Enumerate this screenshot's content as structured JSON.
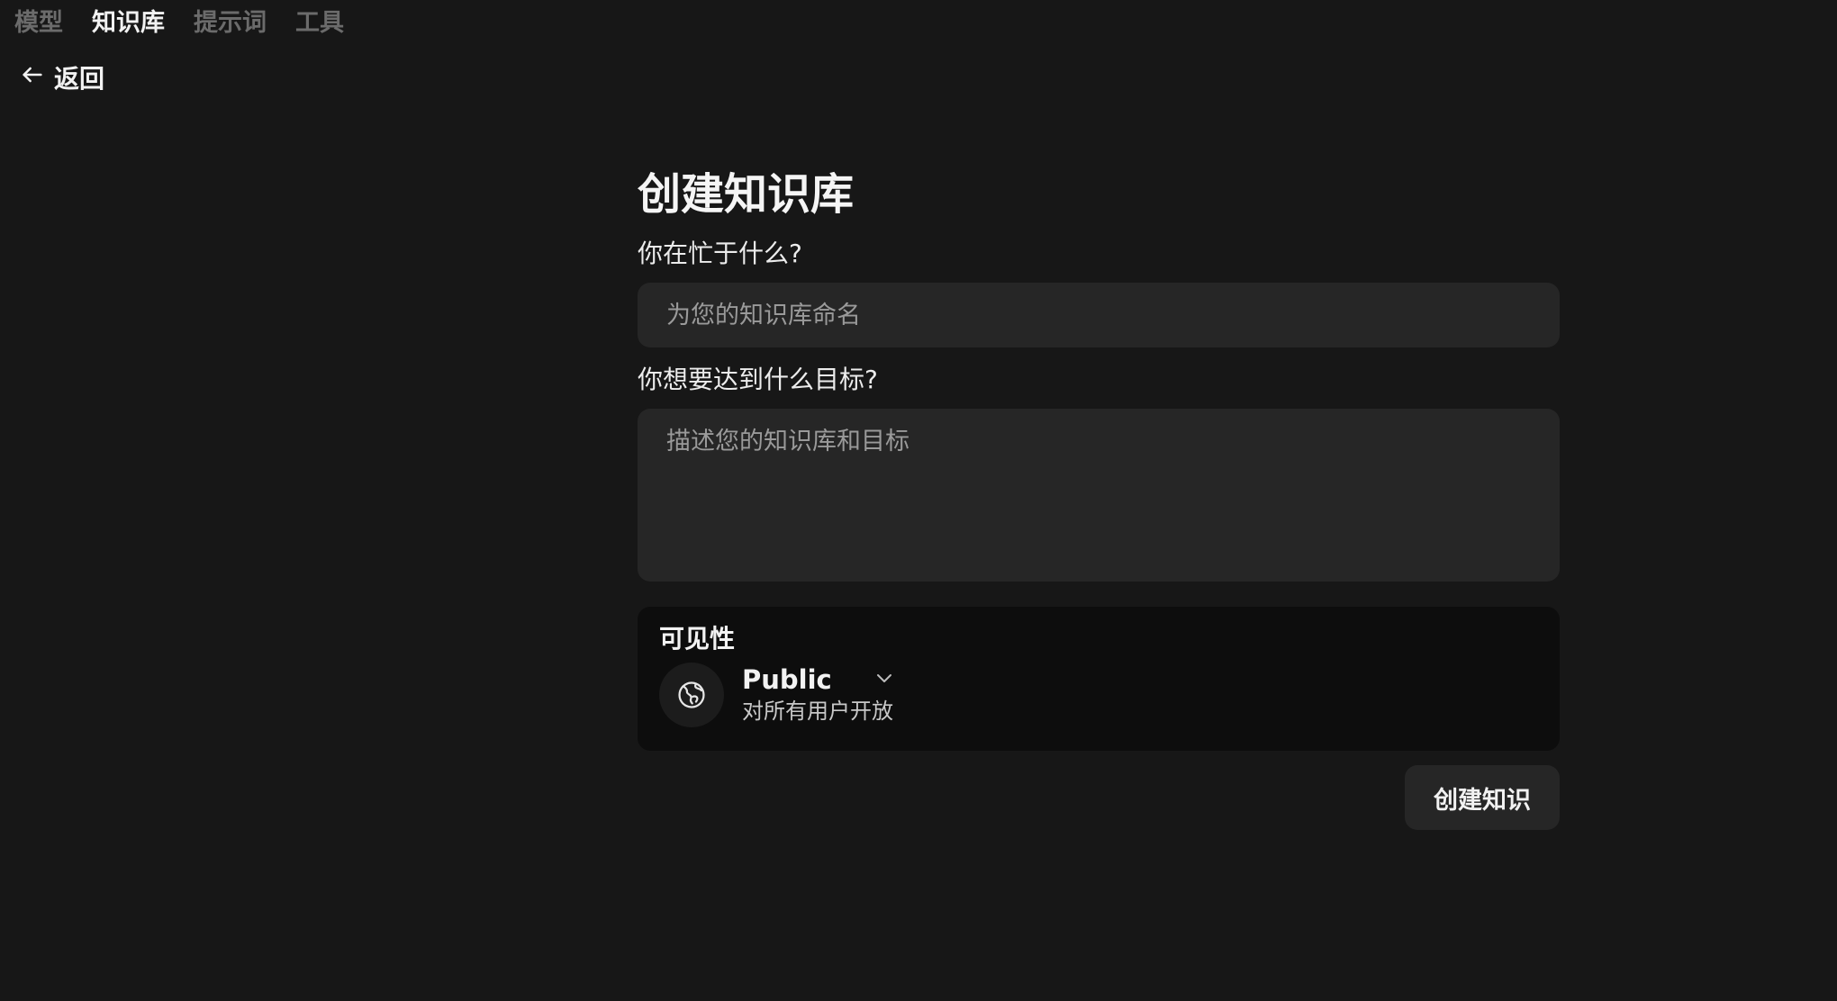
{
  "nav": {
    "tabs": [
      {
        "label": "模型",
        "active": false
      },
      {
        "label": "知识库",
        "active": true
      },
      {
        "label": "提示词",
        "active": false
      },
      {
        "label": "工具",
        "active": false
      }
    ],
    "back_label": "返回",
    "back_icon": "arrow-left-icon"
  },
  "form": {
    "title": "创建知识库",
    "name_label": "你在忙于什么?",
    "name_placeholder": "为您的知识库命名",
    "name_value": "",
    "goal_label": "你想要达到什么目标?",
    "goal_placeholder": "描述您的知识库和目标",
    "goal_value": "",
    "visibility": {
      "title": "可见性",
      "icon": "globe-icon",
      "selected": "Public",
      "description": "对所有用户开放"
    },
    "submit_label": "创建知识"
  },
  "colors": {
    "background": "#171717",
    "field_bg": "#262626",
    "panel_bg": "#0d0d0d",
    "muted_text": "#6b6b6b"
  }
}
